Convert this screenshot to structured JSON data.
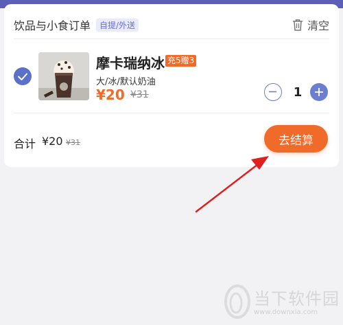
{
  "header": {
    "title": "饮品与小食订单",
    "tag": "自提/外送",
    "clear_label": "清空"
  },
  "item": {
    "name": "摩卡瑞纳冰",
    "promo": "充5赠3",
    "spec": "大/冰/默认奶油",
    "price": "¥20",
    "original_price": "¥31",
    "quantity": "1",
    "selected": true
  },
  "footer": {
    "total_label": "合计",
    "total_price": "¥20",
    "total_original": "¥31",
    "checkout_label": "去结算"
  },
  "watermark": {
    "title": "当下软件园",
    "url": "www.downxia.com"
  },
  "colors": {
    "accent": "#f06a2a",
    "primary": "#5b70c9",
    "annotation_arrow": "#e02020"
  }
}
